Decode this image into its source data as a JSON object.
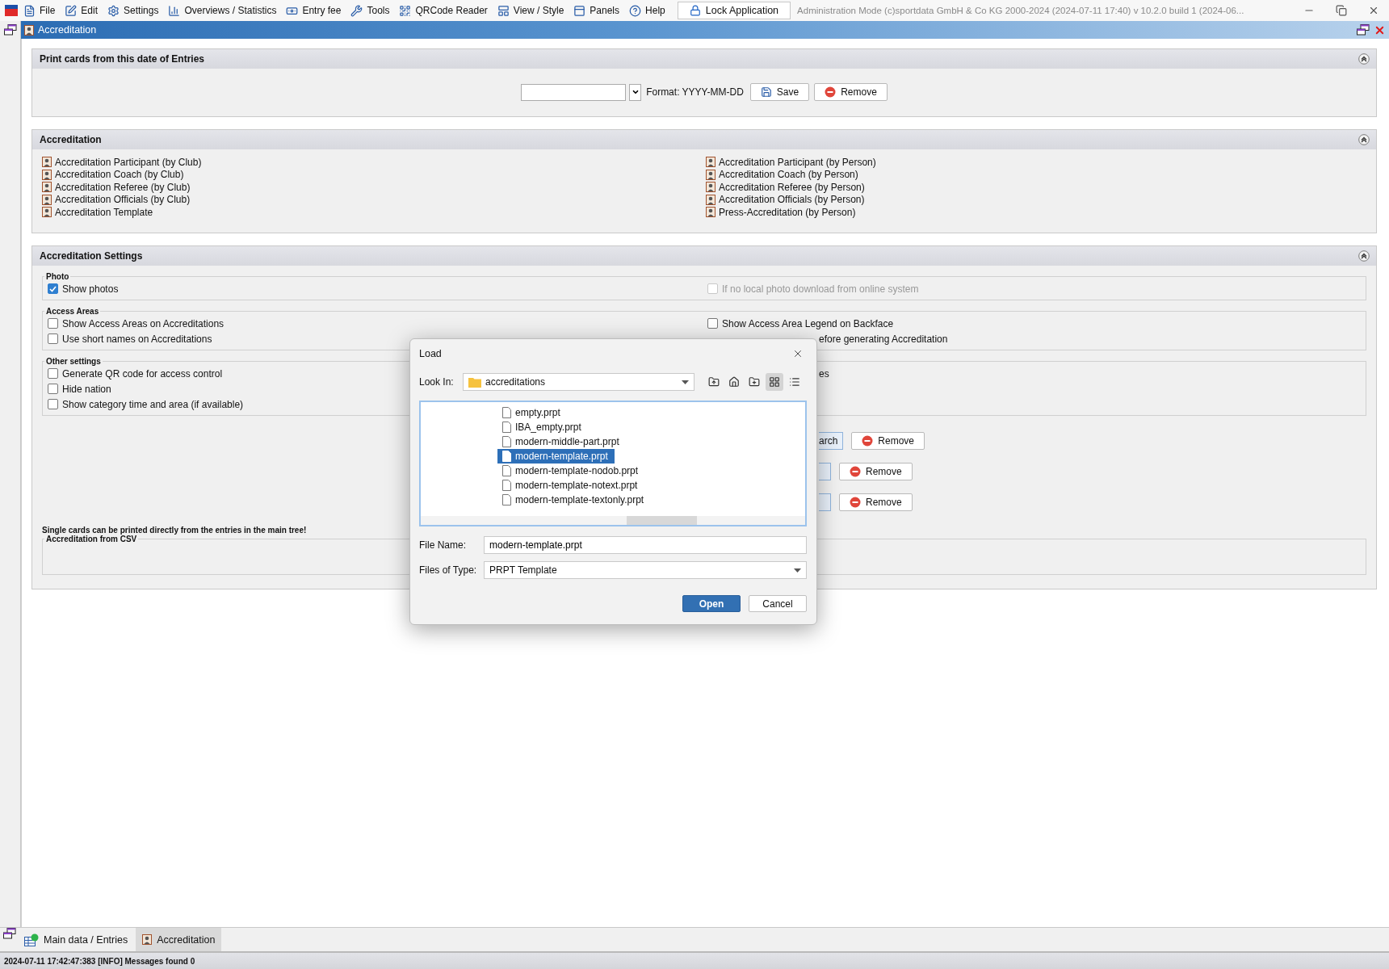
{
  "menu_bar": {
    "items": [
      {
        "label": "File",
        "kind": "file"
      },
      {
        "label": "Edit",
        "kind": "edit"
      },
      {
        "label": "Settings",
        "kind": "settings"
      },
      {
        "label": "Overviews / Statistics",
        "kind": "stats"
      },
      {
        "label": "Entry fee",
        "kind": "fee"
      },
      {
        "label": "Tools",
        "kind": "tools"
      },
      {
        "label": "QRCode Reader",
        "kind": "qr"
      },
      {
        "label": "View / Style",
        "kind": "view"
      },
      {
        "label": "Panels",
        "kind": "panels"
      },
      {
        "label": "Help",
        "kind": "help"
      }
    ],
    "lock_button": "Lock Application",
    "info": "Administration Mode (c)sportdata GmbH & Co KG 2000-2024 (2024-07-11 17:40) v 10.2.0 build 1 (2024-06..."
  },
  "window": {
    "title": "Accreditation"
  },
  "print_date_panel": {
    "title": "Print cards from this date of Entries",
    "format_hint": "Format: YYYY-MM-DD",
    "save_button": "Save",
    "remove_button": "Remove"
  },
  "accreditation_panel": {
    "title": "Accreditation",
    "left_items": [
      "Accreditation Participant (by Club)",
      "Accreditation Coach (by Club)",
      "Accreditation Referee (by Club)",
      "Accreditation Officials (by Club)",
      "Accreditation Template"
    ],
    "right_items": [
      "Accreditation Participant (by Person)",
      "Accreditation Coach (by Person)",
      "Accreditation Referee (by Person)",
      "Accreditation Officials (by Person)",
      "Press-Accreditation (by Person)"
    ]
  },
  "settings_panel": {
    "title": "Accreditation Settings",
    "groups": [
      {
        "title": "Photo",
        "left": [
          {
            "kind": "checkbox",
            "label": "Show photos",
            "checked": true,
            "disabled": false
          }
        ],
        "right": [
          {
            "kind": "checkbox",
            "label": "If no local photo download from online system",
            "checked": false,
            "disabled": true
          }
        ]
      },
      {
        "title": "Access Areas",
        "left": [
          {
            "kind": "checkbox",
            "label": "Show Access Areas on Accreditations",
            "checked": false,
            "disabled": false
          },
          {
            "kind": "checkbox",
            "label": "Use short names on Accreditations",
            "checked": false,
            "disabled": false
          }
        ],
        "right": [
          {
            "kind": "checkbox",
            "label": "Show Access Area Legend on Backface",
            "checked": false,
            "disabled": false
          },
          {
            "kind": "fragment",
            "label": "efore generating Accreditation"
          }
        ]
      },
      {
        "title": "Other settings",
        "left": [
          {
            "kind": "checkbox",
            "label": "Generate QR code for access control",
            "checked": false,
            "disabled": false
          },
          {
            "kind": "checkbox",
            "label": "Hide nation",
            "checked": false,
            "disabled": false
          },
          {
            "kind": "checkbox",
            "label": "Show category time and area (if available)",
            "checked": false,
            "disabled": false
          }
        ],
        "right": [
          {
            "kind": "fragment",
            "label": "es"
          }
        ]
      }
    ],
    "button_rows": [
      {
        "partial_button": "arch",
        "remove_button": "Remove"
      },
      {
        "remove_button": "Remove"
      },
      {
        "remove_button": "Remove"
      }
    ],
    "note": "Single cards can be printed directly from the entries in the main tree!",
    "csv_group": {
      "title": "Accreditation from CSV"
    }
  },
  "dialog": {
    "title": "Load",
    "look_in_label": "Look In:",
    "look_in_value": "accreditations",
    "view_modes": [
      {
        "kind": "list",
        "selected": true
      },
      {
        "kind": "details",
        "selected": false
      }
    ],
    "files": [
      {
        "name": "empty.prpt",
        "selected": false
      },
      {
        "name": "IBA_empty.prpt",
        "selected": false
      },
      {
        "name": "modern-middle-part.prpt",
        "selected": false
      },
      {
        "name": "modern-template.prpt",
        "selected": true
      },
      {
        "name": "modern-template-nodob.prpt",
        "selected": false
      },
      {
        "name": "modern-template-notext.prpt",
        "selected": false
      },
      {
        "name": "modern-template-textonly.prpt",
        "selected": false
      }
    ],
    "file_name_label": "File Name:",
    "file_name": "modern-template.prpt",
    "file_type_label": "Files of Type:",
    "file_type": "PRPT Template",
    "open_button": "Open",
    "cancel_button": "Cancel"
  },
  "bottom_tabs": [
    {
      "label": "Main data / Entries",
      "selected": false,
      "kind": "entries"
    },
    {
      "label": "Accreditation",
      "selected": true,
      "kind": "accreditation"
    }
  ],
  "status_bar": "2024-07-11 17:42:47:383 [INFO] Messages found 0"
}
